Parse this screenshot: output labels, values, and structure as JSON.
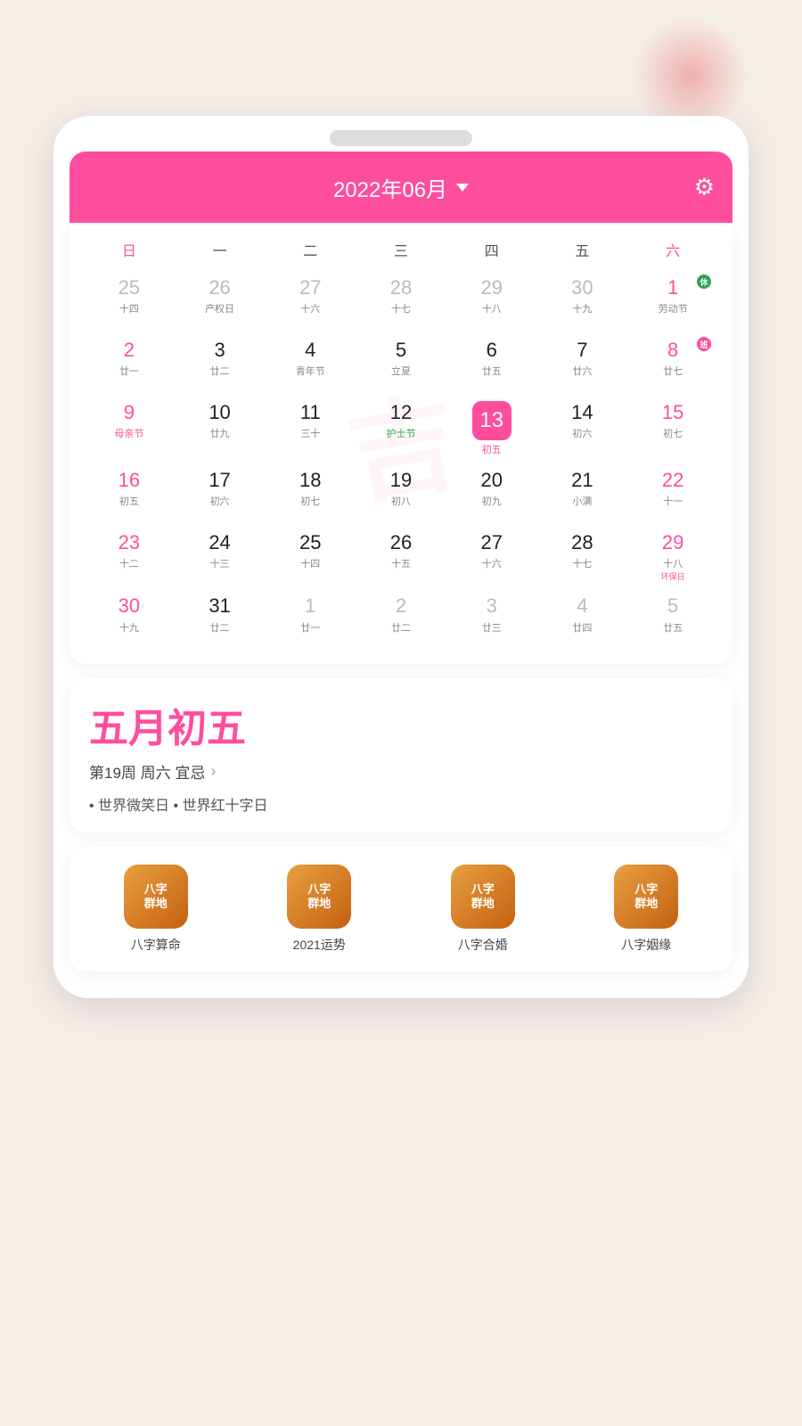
{
  "background": {
    "color": "#f5ede8"
  },
  "header": {
    "month_title": "2022年06月",
    "settings_icon": "⚙"
  },
  "weekdays": [
    "日",
    "一",
    "二",
    "三",
    "四",
    "五",
    "六"
  ],
  "calendar": {
    "weeks": [
      [
        {
          "num": "25",
          "sub": "十四",
          "type": "prev",
          "color": "gray"
        },
        {
          "num": "26",
          "sub": "产权日",
          "type": "prev",
          "color": "gray"
        },
        {
          "num": "27",
          "sub": "十六",
          "type": "prev",
          "color": "gray"
        },
        {
          "num": "28",
          "sub": "十七",
          "type": "prev",
          "color": "gray"
        },
        {
          "num": "29",
          "sub": "十八",
          "type": "prev",
          "color": "gray"
        },
        {
          "num": "30",
          "sub": "十九",
          "type": "prev",
          "color": "gray"
        },
        {
          "num": "1",
          "sub": "劳动节",
          "type": "cur",
          "color": "pink",
          "badge": "休",
          "badge_color": "green"
        }
      ],
      [
        {
          "num": "2",
          "sub": "廿一",
          "type": "cur",
          "color": "pink"
        },
        {
          "num": "3",
          "sub": "廿二",
          "type": "cur",
          "color": "black"
        },
        {
          "num": "4",
          "sub": "青年节",
          "type": "cur",
          "color": "black"
        },
        {
          "num": "5",
          "sub": "立夏",
          "type": "cur",
          "color": "black"
        },
        {
          "num": "6",
          "sub": "廿五",
          "type": "cur",
          "color": "black"
        },
        {
          "num": "7",
          "sub": "廿六",
          "type": "cur",
          "color": "black"
        },
        {
          "num": "8",
          "sub": "廿七",
          "type": "cur",
          "color": "pink",
          "badge": "班",
          "badge_color": "pink"
        }
      ],
      [
        {
          "num": "9",
          "sub": "母亲节",
          "type": "cur",
          "color": "pink",
          "sub_color": "festival"
        },
        {
          "num": "10",
          "sub": "廿九",
          "type": "cur",
          "color": "black"
        },
        {
          "num": "11",
          "sub": "三十",
          "type": "cur",
          "color": "black"
        },
        {
          "num": "12",
          "sub": "护士节",
          "type": "cur",
          "color": "black",
          "sub_color": "green"
        },
        {
          "num": "13",
          "sub": "初五",
          "type": "today",
          "color": "today"
        },
        {
          "num": "14",
          "sub": "初六",
          "type": "cur",
          "color": "black"
        },
        {
          "num": "15",
          "sub": "初七",
          "type": "cur",
          "color": "pink"
        }
      ],
      [
        {
          "num": "16",
          "sub": "初五",
          "type": "cur",
          "color": "pink"
        },
        {
          "num": "17",
          "sub": "初六",
          "type": "cur",
          "color": "black"
        },
        {
          "num": "18",
          "sub": "初七",
          "type": "cur",
          "color": "black"
        },
        {
          "num": "19",
          "sub": "初八",
          "type": "cur",
          "color": "black"
        },
        {
          "num": "20",
          "sub": "初九",
          "type": "cur",
          "color": "black"
        },
        {
          "num": "21",
          "sub": "小满",
          "type": "cur",
          "color": "black"
        },
        {
          "num": "22",
          "sub": "十一",
          "type": "cur",
          "color": "pink"
        }
      ],
      [
        {
          "num": "23",
          "sub": "十二",
          "type": "cur",
          "color": "pink"
        },
        {
          "num": "24",
          "sub": "十三",
          "type": "cur",
          "color": "black"
        },
        {
          "num": "25",
          "sub": "十四",
          "type": "cur",
          "color": "black"
        },
        {
          "num": "26",
          "sub": "十五",
          "type": "cur",
          "color": "black"
        },
        {
          "num": "27",
          "sub": "十六",
          "type": "cur",
          "color": "black"
        },
        {
          "num": "28",
          "sub": "十七",
          "type": "cur",
          "color": "black"
        },
        {
          "num": "29",
          "sub": "十八",
          "type": "cur",
          "color": "pink",
          "badge2": "环保日"
        }
      ],
      [
        {
          "num": "30",
          "sub": "十九",
          "type": "cur",
          "color": "pink"
        },
        {
          "num": "31",
          "sub": "廿二",
          "type": "cur",
          "color": "black"
        },
        {
          "num": "1",
          "sub": "廿一",
          "type": "next",
          "color": "gray"
        },
        {
          "num": "2",
          "sub": "廿二",
          "type": "next",
          "color": "gray"
        },
        {
          "num": "3",
          "sub": "廿三",
          "type": "next",
          "color": "gray"
        },
        {
          "num": "4",
          "sub": "廿四",
          "type": "next",
          "color": "gray"
        },
        {
          "num": "5",
          "sub": "廿五",
          "type": "next",
          "color": "gray"
        }
      ]
    ],
    "watermark": "吉"
  },
  "info": {
    "lunar_date": "五月初五",
    "week_info": "第19周 周六 宜忌",
    "festivals": "• 世界微笑日  • 世界红十字日"
  },
  "tools": [
    {
      "label": "八字算命"
    },
    {
      "label": "2021运势"
    },
    {
      "label": "八字合婚"
    },
    {
      "label": "八字姻缘"
    }
  ]
}
